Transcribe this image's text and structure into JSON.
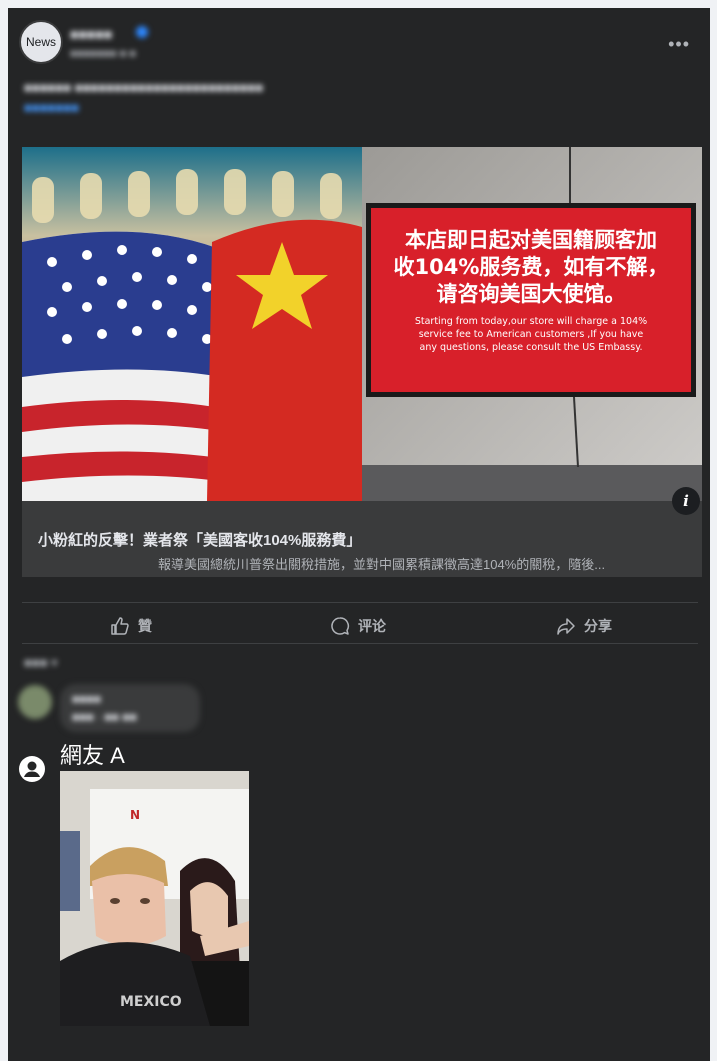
{
  "post": {
    "avatar_text": "News",
    "page_name": "■■■■■",
    "time": "■■■■■■■ ■ ■",
    "more": "•••",
    "caption": "■■■■■■ ■■■■■■■■■■■■■■■■■■■■■■■■",
    "caption_link": "■■■■■■■"
  },
  "link_preview": {
    "sign_zh_line1": "本店即日起对美国籍顾客加",
    "sign_zh_line2": "收104%服务费，如有不解，",
    "sign_zh_line3": "请咨询美国大使馆。",
    "sign_en_line1": "Starting from today,our store will charge a 104%",
    "sign_en_line2": "service fee to American customers ,If you have",
    "sign_en_line3": "any questions, please consult the US Embassy.",
    "info": "i",
    "title": "小粉紅的反擊！業者祭「美國客收104%服務費」",
    "description": "報導美國總統川普祭出關稅措施，並對中國累積課徵高達104%的關稅，隨後..."
  },
  "actions": {
    "like": "贊",
    "comment": "评论",
    "share": "分享"
  },
  "comments": {
    "sort_label": "■■■ ▾",
    "first_author": "■■■■",
    "first_text": "■■■ · ■■ ■■"
  },
  "reply": {
    "author": "網友 A",
    "meme_shirt_text": "MEXICO"
  },
  "colors": {
    "card_bg": "#242526",
    "page_bg": "#f0f2f5",
    "sign_red": "#d8202a",
    "link_blue": "#4599ff"
  }
}
